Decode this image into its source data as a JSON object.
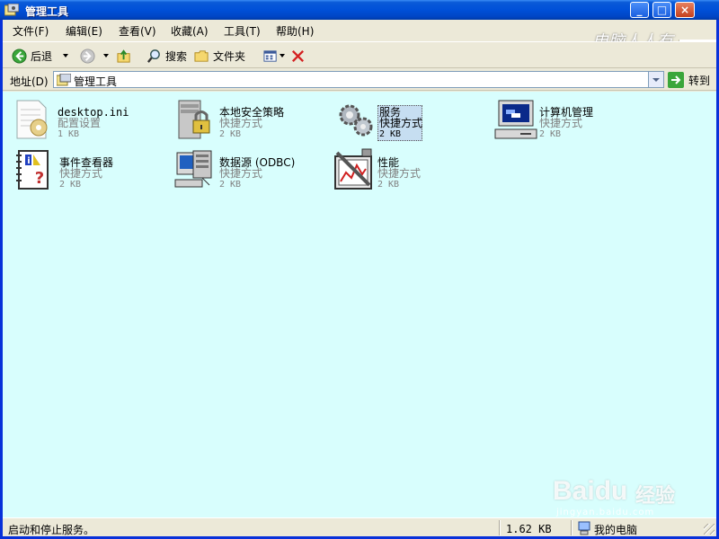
{
  "window": {
    "title": "管理工具",
    "minimize_label": "_",
    "maximize_label": "□",
    "close_label": "×"
  },
  "menu": {
    "items": [
      {
        "label": "文件(F)"
      },
      {
        "label": "编辑(E)"
      },
      {
        "label": "查看(V)"
      },
      {
        "label": "收藏(A)"
      },
      {
        "label": "工具(T)"
      },
      {
        "label": "帮助(H)"
      }
    ]
  },
  "toolbar": {
    "back_label": "后退",
    "search_label": "搜索",
    "folders_label": "文件夹"
  },
  "address": {
    "label": "地址(D)",
    "value": "管理工具",
    "go_label": "转到"
  },
  "files": [
    {
      "name": "desktop.ini",
      "type": "配置设置",
      "size": "1 KB",
      "icon": "settings-file-icon",
      "selected": false
    },
    {
      "name": "本地安全策略",
      "type": "快捷方式",
      "size": "2 KB",
      "icon": "local-security-policy-icon",
      "selected": false
    },
    {
      "name": "服务",
      "type": "快捷方式",
      "size": "2 KB",
      "icon": "services-gears-icon",
      "selected": true
    },
    {
      "name": "计算机管理",
      "type": "快捷方式",
      "size": "2 KB",
      "icon": "computer-management-icon",
      "selected": false
    },
    {
      "name": "事件查看器",
      "type": "快捷方式",
      "size": "2 KB",
      "icon": "event-viewer-icon",
      "selected": false
    },
    {
      "name": "数据源 (ODBC)",
      "type": "快捷方式",
      "size": "2 KB",
      "icon": "data-source-odbc-icon",
      "selected": false
    },
    {
      "name": "性能",
      "type": "快捷方式",
      "size": "2 KB",
      "icon": "performance-icon",
      "selected": false
    }
  ],
  "status": {
    "description": "启动和停止服务。",
    "size": "1.62 KB",
    "location": "我的电脑"
  },
  "watermark": {
    "top": "电脑人人有",
    "brand": "Bai",
    "brand_suffix": "du",
    "jingyan": "经验",
    "url": "jingyan.baidu.com"
  },
  "colors": {
    "titlebar": "#0050d8",
    "content_background": "#d8fefd",
    "chrome": "#ece9d8"
  }
}
